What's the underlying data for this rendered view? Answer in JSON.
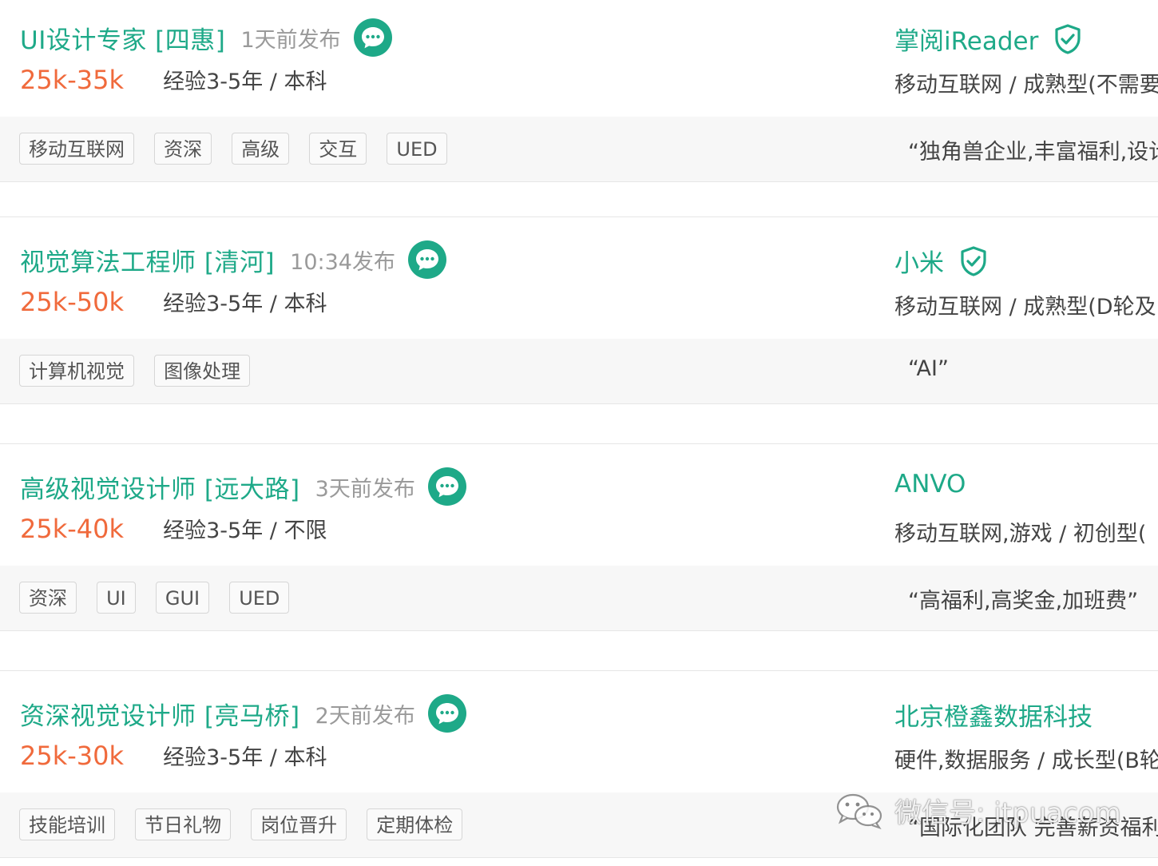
{
  "jobs": [
    {
      "title": "UI设计专家 [四惠]",
      "posted": "1天前发布",
      "salary": "25k-35k",
      "requirements": "经验3-5年 / 本科",
      "company": "掌阅iReader",
      "verified": true,
      "industry": "移动互联网 / 成熟型(不需要",
      "tags": [
        "移动互联网",
        "资深",
        "高级",
        "交互",
        "UED"
      ],
      "slogan": "“独角兽企业,丰富福利,设计"
    },
    {
      "title": "视觉算法工程师 [清河]",
      "posted": "10:34发布",
      "salary": "25k-50k",
      "requirements": "经验3-5年 / 本科",
      "company": "小米",
      "verified": true,
      "industry": "移动互联网 / 成熟型(D轮及",
      "tags": [
        "计算机视觉",
        "图像处理"
      ],
      "slogan": "“AI”"
    },
    {
      "title": "高级视觉设计师 [远大路]",
      "posted": "3天前发布",
      "salary": "25k-40k",
      "requirements": "经验3-5年 / 不限",
      "company": "ANVO",
      "verified": false,
      "industry": "移动互联网,游戏 / 初创型(",
      "tags": [
        "资深",
        "UI",
        "GUI",
        "UED"
      ],
      "slogan": "“高福利,高奖金,加班费”"
    },
    {
      "title": "资深视觉设计师 [亮马桥]",
      "posted": "2天前发布",
      "salary": "25k-30k",
      "requirements": "经验3-5年 / 本科",
      "company": "北京橙鑫数据科技",
      "verified": false,
      "industry": "硬件,数据服务 / 成长型(B轮",
      "tags": [
        "技能培训",
        "节日礼物",
        "岗位晋升",
        "定期体检"
      ],
      "slogan": "“国际化团队 完善薪资福利"
    }
  ],
  "watermark": {
    "text": "微信号: itpuacom",
    "icon": "wechat-icon"
  },
  "colors": {
    "accent": "#1ea988",
    "salary": "#f06a3c",
    "tag_bg": "#fafafa",
    "strip_bg": "#f7f7f7"
  }
}
